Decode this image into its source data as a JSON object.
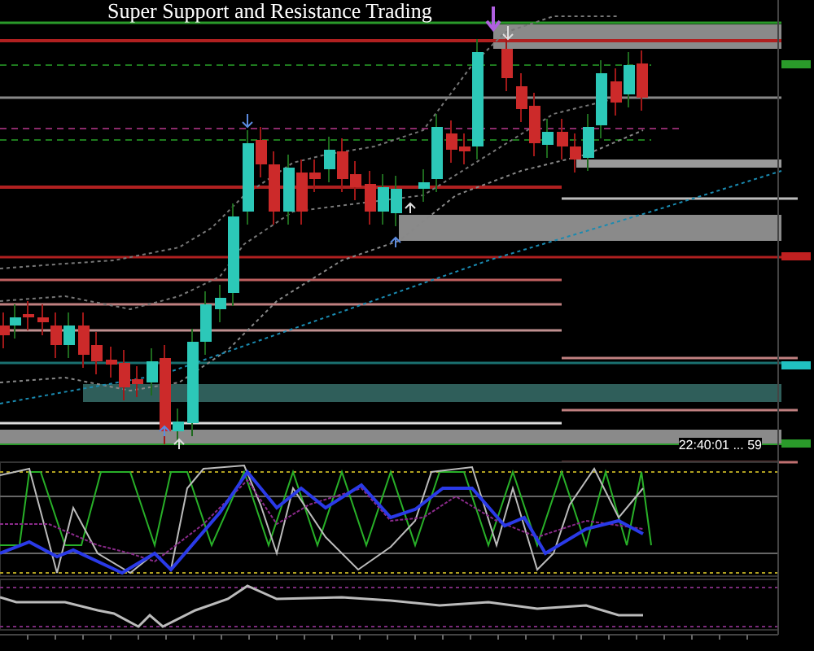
{
  "chart": {
    "title": "Super Support and Resistance Trading",
    "countdown": "22:40:01 ... 59"
  }
}
